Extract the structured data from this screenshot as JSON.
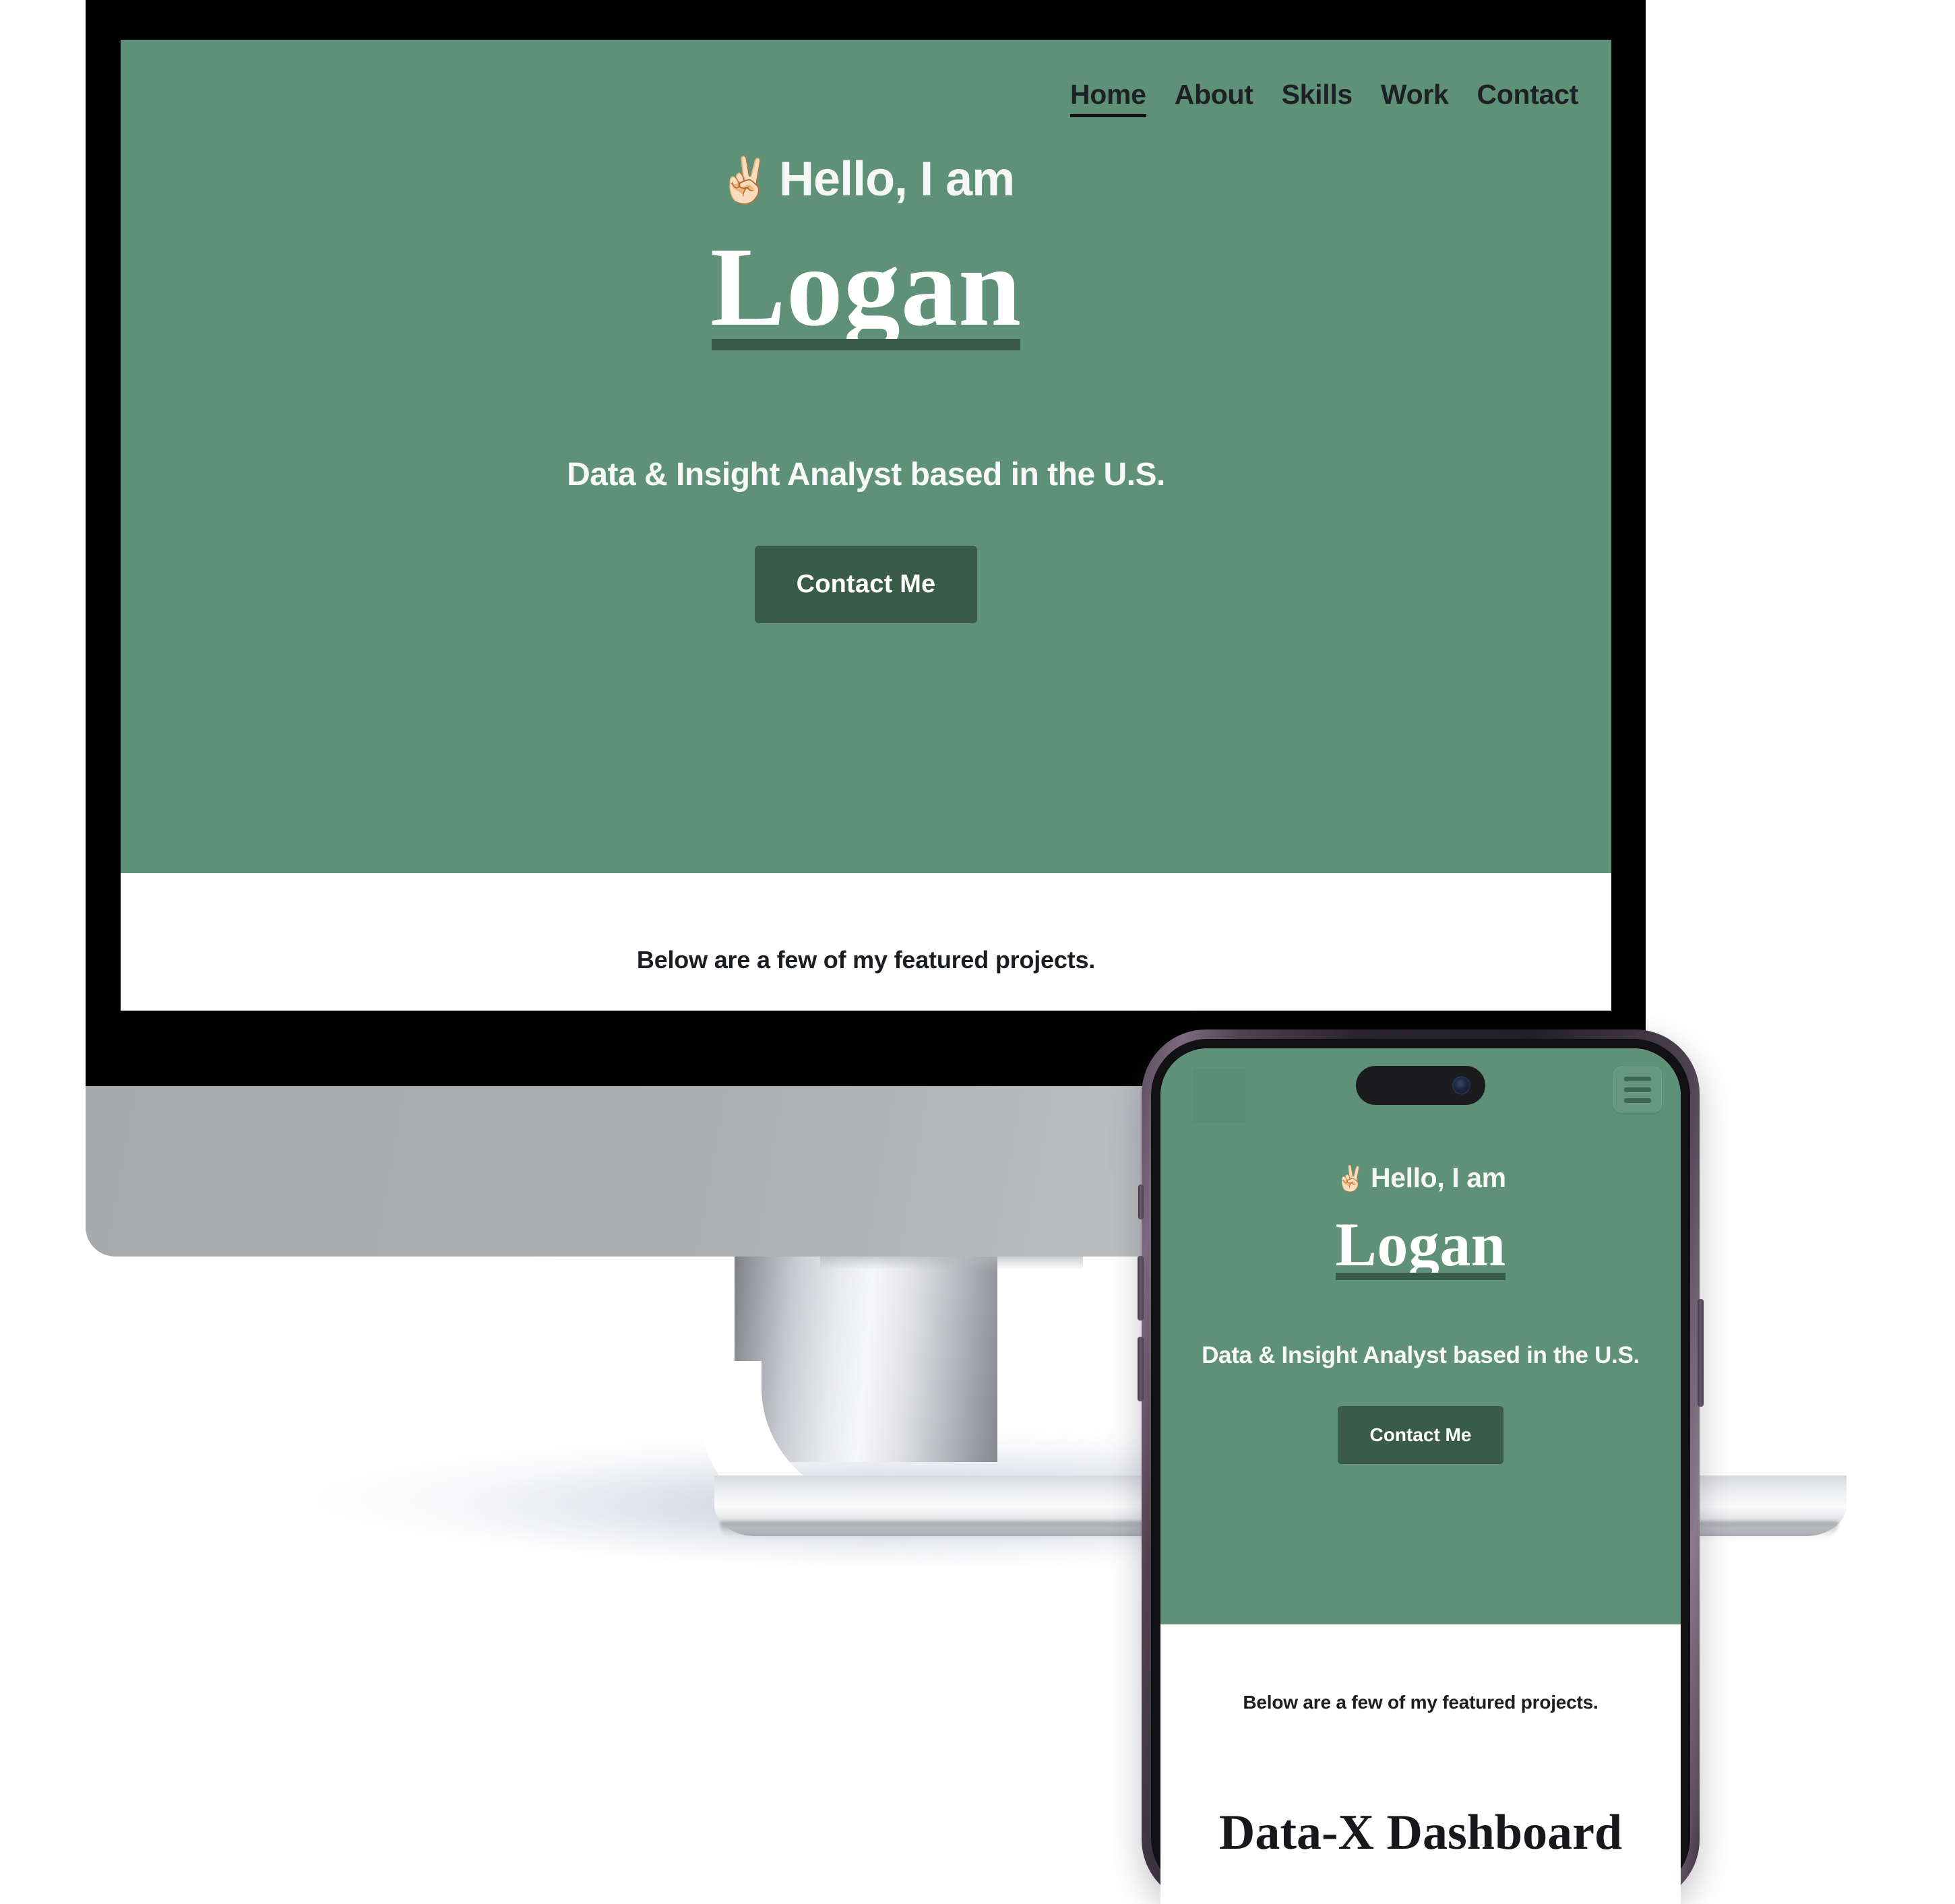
{
  "colors": {
    "hero_green": "#5f9179",
    "dark_green": "#3a5a4a",
    "text_dark": "#1a1d21",
    "white": "#ffffff",
    "phone_frame": "#5b4a5e"
  },
  "desktop": {
    "nav": {
      "items": [
        {
          "label": "Home",
          "active": true
        },
        {
          "label": "About",
          "active": false
        },
        {
          "label": "Skills",
          "active": false
        },
        {
          "label": "Work",
          "active": false
        },
        {
          "label": "Contact",
          "active": false
        }
      ]
    },
    "hero": {
      "wave_emoji": "✌🏻",
      "greeting": "Hello, I am",
      "name": "Logan",
      "tagline": "Data & Insight Analyst based in the U.S.",
      "cta_label": "Contact Me"
    },
    "projects": {
      "intro": "Below are a few of my featured projects."
    }
  },
  "phone": {
    "menu_icon": "hamburger-menu-icon",
    "hero": {
      "wave_emoji": "✌🏻",
      "greeting": "Hello, I am",
      "name": "Logan",
      "tagline": "Data & Insight Analyst based in the U.S.",
      "cta_label": "Contact Me"
    },
    "projects": {
      "intro": "Below are a few of my featured projects.",
      "first_project_title": "Data-X Dashboard"
    }
  }
}
